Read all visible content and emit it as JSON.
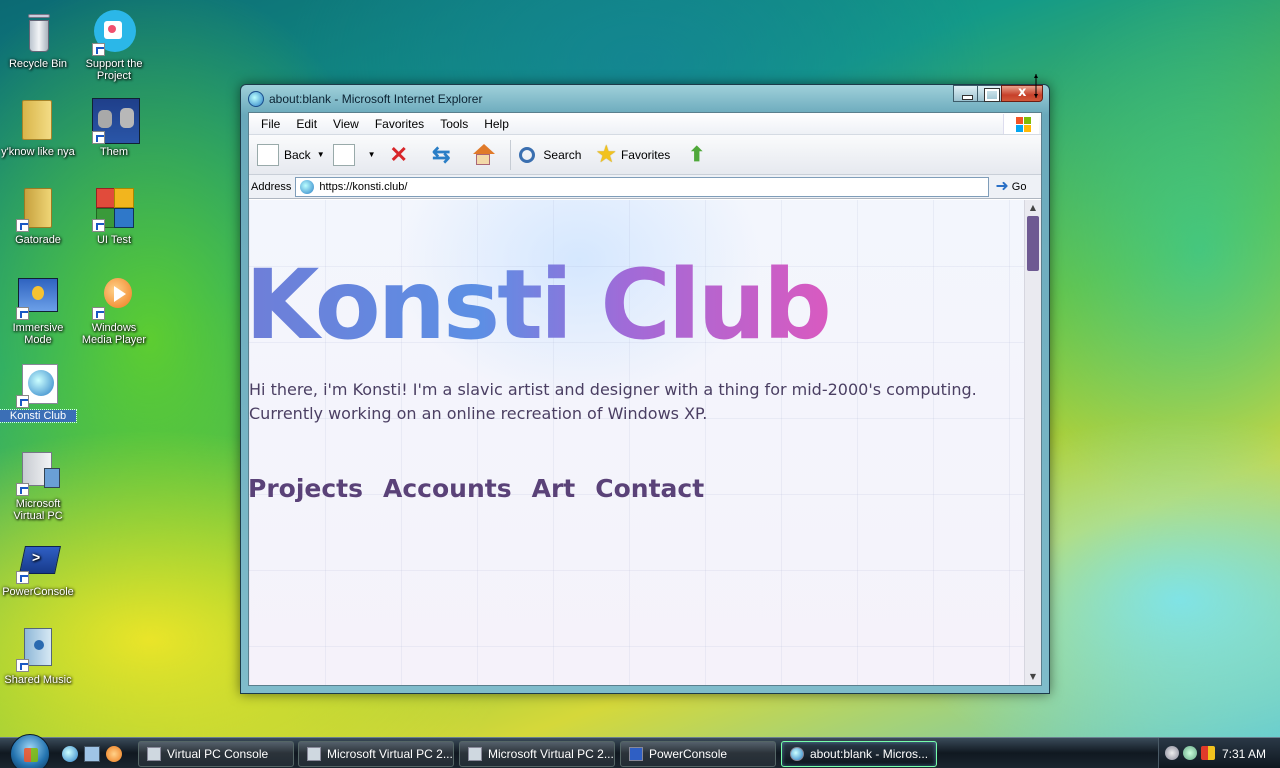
{
  "desktop": {
    "icons": [
      {
        "label": "Recycle Bin"
      },
      {
        "label": "Support the Project"
      },
      {
        "label": "y'know like nya"
      },
      {
        "label": "Them"
      },
      {
        "label": "Gatorade"
      },
      {
        "label": "UI Test"
      },
      {
        "label": "Immersive Mode"
      },
      {
        "label": "Windows Media Player"
      },
      {
        "label": "Konsti Club",
        "selected": true
      },
      {
        "label": "Microsoft Virtual PC"
      },
      {
        "label": "PowerConsole"
      },
      {
        "label": "Shared Music"
      }
    ]
  },
  "window": {
    "title": "about:blank - Microsoft Internet Explorer",
    "menu": [
      "File",
      "Edit",
      "View",
      "Favorites",
      "Tools",
      "Help"
    ],
    "toolbar": {
      "back_label": "Back",
      "search_label": "Search",
      "favorites_label": "Favorites"
    },
    "address": {
      "label": "Address",
      "url": "https://konsti.club/",
      "go_label": "Go"
    },
    "page": {
      "hero_title": "Konsti Club",
      "intro": "Hi there, i'm Konsti! I'm a slavic artist and designer with a thing for mid-2000's computing. Currently working on an online recreation of Windows XP.",
      "nav": [
        "Projects",
        "Accounts",
        "Art",
        "Contact"
      ]
    }
  },
  "taskbar": {
    "buttons": [
      {
        "label": "Virtual PC Console"
      },
      {
        "label": "Microsoft Virtual PC 2..."
      },
      {
        "label": "Microsoft Virtual PC 2..."
      },
      {
        "label": "PowerConsole"
      },
      {
        "label": "about:blank - Micros...",
        "active": true
      }
    ],
    "clock": "7:31 AM"
  },
  "colors": {
    "hero_gradient_start": "#6f7ed8",
    "hero_gradient_end": "#d95ac0",
    "nav_text": "#5a4278",
    "body_text": "#4b3f63"
  }
}
